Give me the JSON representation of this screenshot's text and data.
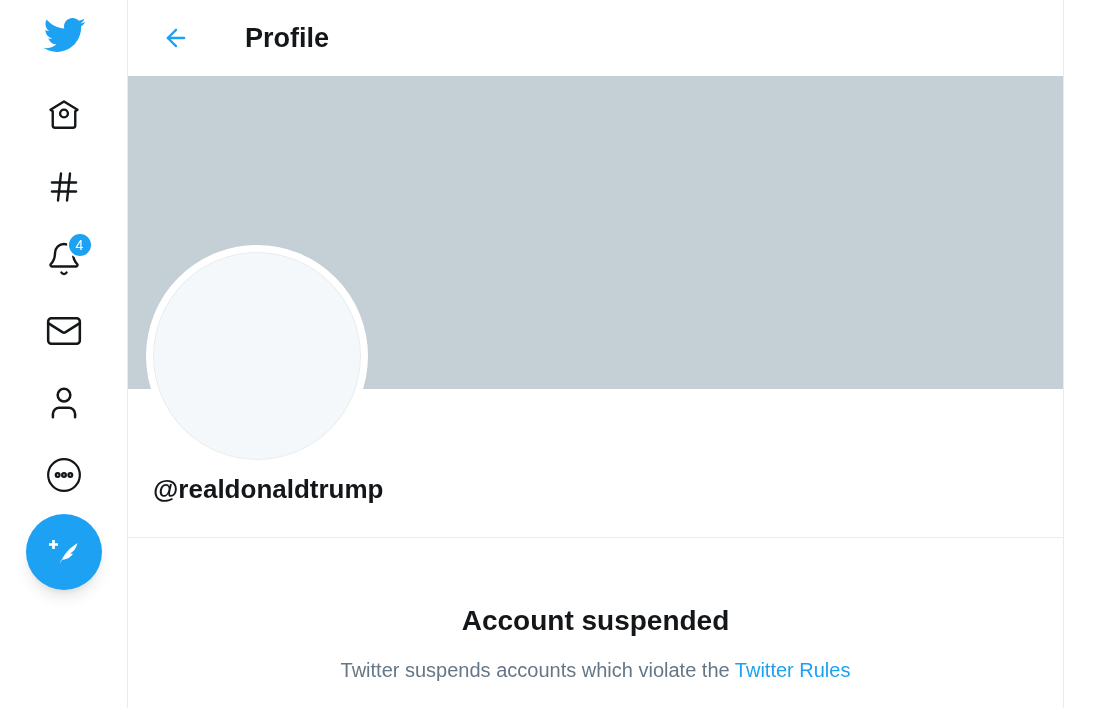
{
  "sidebar": {
    "notifications_badge": "4"
  },
  "header": {
    "title": "Profile"
  },
  "profile": {
    "handle": "@realdonaldtrump"
  },
  "notice": {
    "title": "Account suspended",
    "text": "Twitter suspends accounts which violate the",
    "link": "Twitter Rules"
  }
}
